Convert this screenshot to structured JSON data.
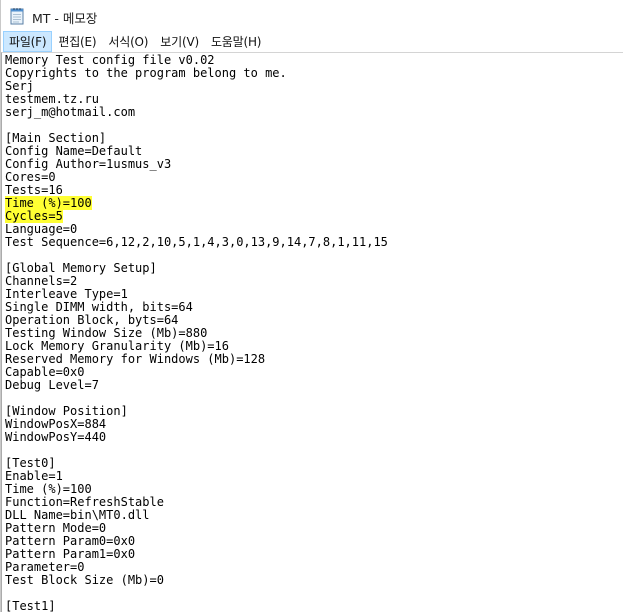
{
  "window": {
    "title": "MT - 메모장",
    "app_icon": "notepad-icon"
  },
  "menu": {
    "items": [
      {
        "label": "파일(F)",
        "active": true
      },
      {
        "label": "편집(E)",
        "active": false
      },
      {
        "label": "서식(O)",
        "active": false
      },
      {
        "label": "보기(V)",
        "active": false
      },
      {
        "label": "도움말(H)",
        "active": false
      }
    ]
  },
  "editor": {
    "highlight_color": "#ffff33",
    "highlighted_lines": [
      11,
      12
    ],
    "lines": [
      "Memory Test config file v0.02",
      "Copyrights to the program belong to me.",
      "Serj",
      "testmem.tz.ru",
      "serj_m@hotmail.com",
      "",
      "[Main Section]",
      "Config Name=Default",
      "Config Author=1usmus_v3",
      "Cores=0",
      "Tests=16",
      "Time (%)=100",
      "Cycles=5",
      "Language=0",
      "Test Sequence=6,12,2,10,5,1,4,3,0,13,9,14,7,8,1,11,15",
      "",
      "[Global Memory Setup]",
      "Channels=2",
      "Interleave Type=1",
      "Single DIMM width, bits=64",
      "Operation Block, byts=64",
      "Testing Window Size (Mb)=880",
      "Lock Memory Granularity (Mb)=16",
      "Reserved Memory for Windows (Mb)=128",
      "Capable=0x0",
      "Debug Level=7",
      "",
      "[Window Position]",
      "WindowPosX=884",
      "WindowPosY=440",
      "",
      "[Test0]",
      "Enable=1",
      "Time (%)=100",
      "Function=RefreshStable",
      "DLL Name=bin\\MT0.dll",
      "Pattern Mode=0",
      "Pattern Param0=0x0",
      "Pattern Param1=0x0",
      "Parameter=0",
      "Test Block Size (Mb)=0",
      "",
      "[Test1]"
    ]
  }
}
